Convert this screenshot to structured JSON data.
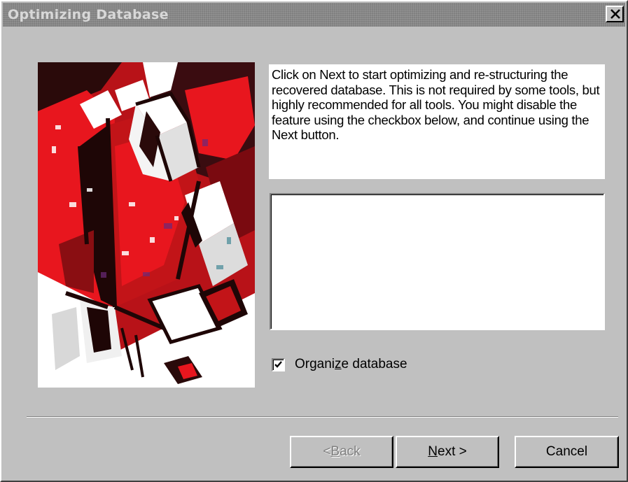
{
  "window": {
    "title": "Optimizing Database",
    "close_label": "close"
  },
  "info": {
    "text": "Click on Next to start optimizing and re-structuring the recovered database. This is not required by some tools, but highly recommended for all tools. You might disable the feature using the checkbox below, and continue using the Next button."
  },
  "log": {
    "content": ""
  },
  "options": {
    "organize_label_pre": "Organi",
    "organize_label_hotkey": "z",
    "organize_label_post": "e database",
    "organize_checked": true
  },
  "buttons": {
    "back_prefix": "< ",
    "back_hotkey": "B",
    "back_rest": "ack",
    "back_enabled": false,
    "next_hotkey": "N",
    "next_rest": "ext >",
    "cancel_label": "Cancel"
  },
  "colors": {
    "face": "#c0c0c0",
    "titlebar_inactive": "#808080",
    "image_red": "#e8161e",
    "image_dark": "#2a0a0a"
  },
  "icons": {
    "close": "close-x-icon",
    "check": "check-icon",
    "wizard_art": "wizard-cubes-image"
  }
}
